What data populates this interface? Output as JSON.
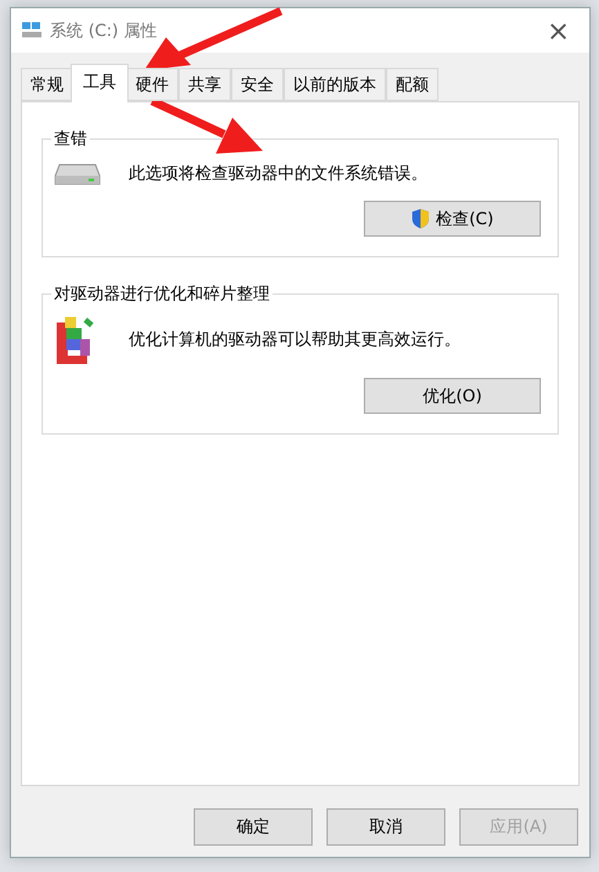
{
  "window": {
    "title": "系统 (C:) 属性",
    "close": "×"
  },
  "tabs": [
    {
      "label": "常规",
      "selected": false
    },
    {
      "label": "工具",
      "selected": true
    },
    {
      "label": "硬件",
      "selected": false
    },
    {
      "label": "共享",
      "selected": false
    },
    {
      "label": "安全",
      "selected": false
    },
    {
      "label": "以前的版本",
      "selected": false
    },
    {
      "label": "配额",
      "selected": false
    }
  ],
  "groups": [
    {
      "kind": "check",
      "title": "查错",
      "description": "此选项将检查驱动器中的文件系统错误。",
      "button": {
        "label": "检查(C)",
        "shield": true
      }
    },
    {
      "kind": "optimize",
      "title": "对驱动器进行优化和碎片整理",
      "description": "优化计算机的驱动器可以帮助其更高效运行。",
      "button": {
        "label": "优化(O)",
        "shield": false
      }
    }
  ],
  "buttons": [
    {
      "label": "确定",
      "disabled": false
    },
    {
      "label": "取消",
      "disabled": false
    },
    {
      "label": "应用(A)",
      "disabled": true
    }
  ],
  "annotations": [
    {
      "kind": "arrow"
    },
    {
      "kind": "arrow"
    }
  ]
}
